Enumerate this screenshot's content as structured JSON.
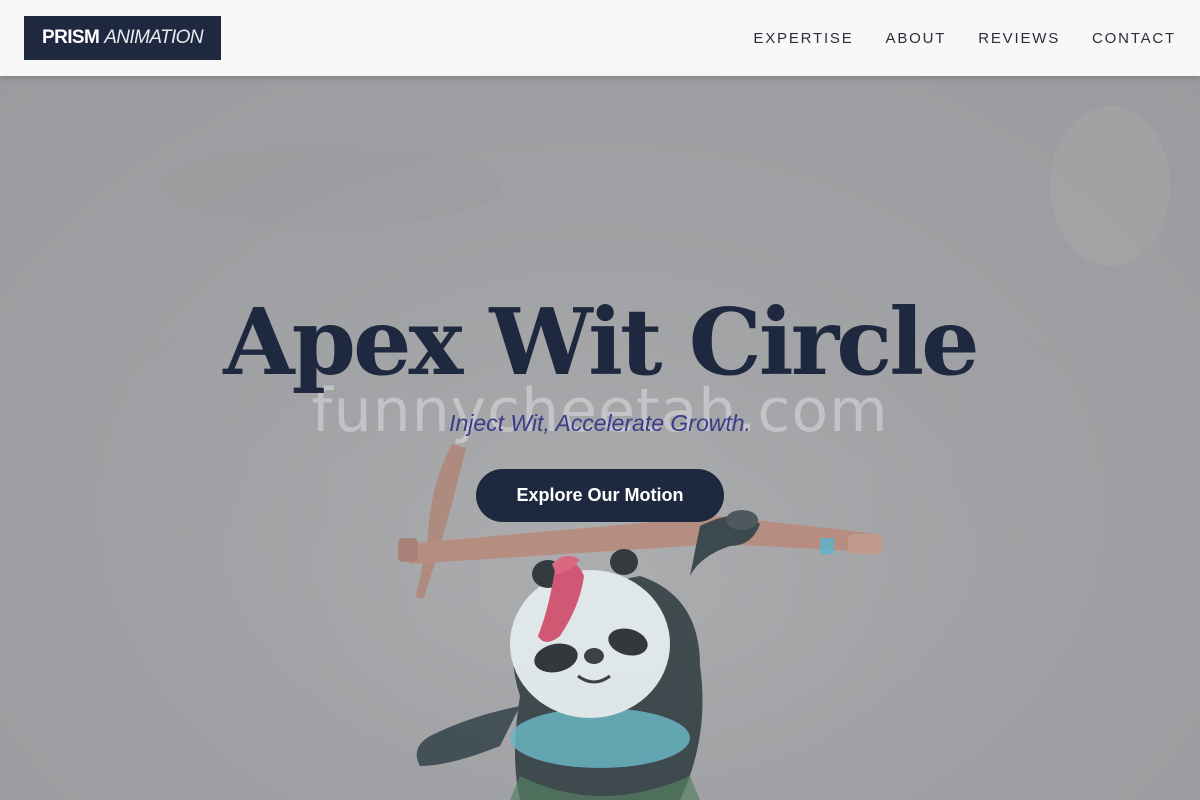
{
  "header": {
    "logo_primary": "PRISM",
    "logo_secondary": "ANIMATION",
    "nav": [
      {
        "label": "EXPERTISE"
      },
      {
        "label": "ABOUT"
      },
      {
        "label": "REVIEWS"
      },
      {
        "label": "CONTACT"
      }
    ]
  },
  "hero": {
    "title": "Apex Wit Circle",
    "subtitle": "Inject Wit, Accelerate Growth.",
    "cta_label": "Explore Our Motion",
    "watermark": "funnycheetah.com",
    "image_subject": "panda-figurine-with-bow"
  },
  "colors": {
    "primary": "#1e2940",
    "accent": "#3f3a8a",
    "header_bg": "#f7f7f8",
    "hero_overlay": "#a3a4a6"
  }
}
